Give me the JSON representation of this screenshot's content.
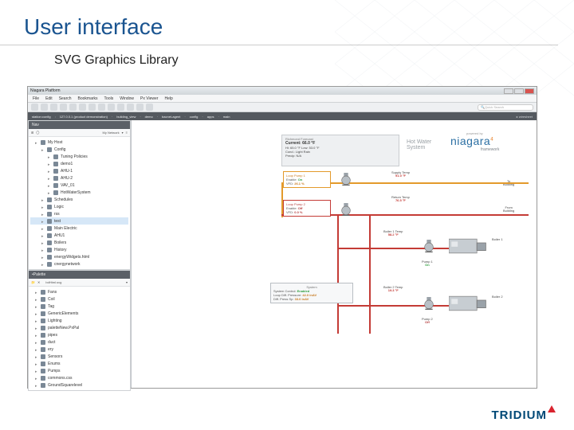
{
  "slide": {
    "title": "User interface",
    "subtitle": "SVG Graphics Library"
  },
  "window": {
    "title": "Niagara Platform"
  },
  "menu": [
    "File",
    "Edit",
    "Search",
    "Bookmarks",
    "Tools",
    "Window",
    "Px Viewer",
    "Help"
  ],
  "toolbar": {
    "search_placeholder": "Quick Search"
  },
  "path": {
    "crumbs": [
      "station:config",
      "127.0.0.1 (product demonstration)",
      "building_view",
      "demo",
      "bacnet-agent",
      "config",
      "apps",
      "main"
    ],
    "right": "wiresheet"
  },
  "nav": {
    "title": "Nav",
    "selector": "My Network",
    "items": [
      {
        "label": "My Host",
        "indent": 0
      },
      {
        "label": "Config",
        "indent": 1
      },
      {
        "label": "Tuning Policies",
        "indent": 2
      },
      {
        "label": "demo1",
        "indent": 2
      },
      {
        "label": "AHU-1",
        "indent": 2
      },
      {
        "label": "AHU-2",
        "indent": 2
      },
      {
        "label": "VAV_01",
        "indent": 2
      },
      {
        "label": "HotWaterSystem",
        "indent": 2,
        "sel": false
      },
      {
        "label": "Schedules",
        "indent": 1
      },
      {
        "label": "Logic",
        "indent": 1
      },
      {
        "label": "rss",
        "indent": 1
      },
      {
        "label": "test",
        "indent": 1,
        "sel": true
      },
      {
        "label": "Main Electric",
        "indent": 1
      },
      {
        "label": "AHU1",
        "indent": 1
      },
      {
        "label": "Boilers",
        "indent": 1
      },
      {
        "label": "History",
        "indent": 1
      },
      {
        "label": "energyWidgets.html",
        "indent": 1
      },
      {
        "label": "cnergynetwork",
        "indent": 1
      }
    ]
  },
  "palette": {
    "title": "Palette",
    "selector": "bdHtml.svg",
    "items": [
      {
        "label": "Fans"
      },
      {
        "label": "Coil"
      },
      {
        "label": "Tag"
      },
      {
        "label": "GenericElements"
      },
      {
        "label": "Lighting"
      },
      {
        "label": "paletteNew.PxPal"
      },
      {
        "label": "pipes"
      },
      {
        "label": "duct"
      },
      {
        "label": "ery"
      },
      {
        "label": "Sensors"
      },
      {
        "label": "Enums"
      },
      {
        "label": "Pumps"
      },
      {
        "label": "commons.css"
      },
      {
        "label": "GroundSquarelevel"
      }
    ]
  },
  "forecast": {
    "title": "Richmond Forecast",
    "current_label": "Current:",
    "current": "66.0 °F",
    "hi_lo": "Hi: 65.0 °F  Low: 53.0 °F",
    "cond": "Cond.: Light Rain",
    "precip": "Precip: N/A"
  },
  "hws_label": "Hot Water\nSystem",
  "niagara": {
    "powered": "powered by",
    "brand": "niagara",
    "sup": "4",
    "sub": "framework"
  },
  "loop1": {
    "title": "Loop Pump 1",
    "enable_l": "Enable:",
    "enable_v": "On",
    "vfd_l": "VFD:",
    "vfd_v": "26.1 %"
  },
  "loop2": {
    "title": "Loop Pump 2",
    "enable_l": "Enable:",
    "enable_v": "Off",
    "vfd_l": "VFD:",
    "vfd_v": "0.0 %"
  },
  "supply": {
    "label": "Supply Temp",
    "val": "91.0 °F"
  },
  "return": {
    "label": "Return Temp",
    "val": "76.5 °F"
  },
  "to_bldg": "To\nBuilding",
  "from_bldg": "From\nBuilding",
  "boiler1": {
    "label": "Boiler 1 Temp",
    "val": "58.2 °F",
    "name": "Boiler 1"
  },
  "boiler2": {
    "label": "Boiler 2 Temp",
    "val": "19.3 °F",
    "name": "Boiler 2"
  },
  "pump1": {
    "label": "Pump 1",
    "state": "On"
  },
  "pump2": {
    "label": "Pump 2",
    "state": "Off"
  },
  "system_box": {
    "title": "System",
    "ctrl_l": "System Control:",
    "ctrl_v": "Enabled",
    "loop_l": "Loop Diff. Pressure:",
    "loop_v": "42.0 inAV",
    "diff_l": "Diff. Press Sp:",
    "diff_v": "33.0 inAV"
  },
  "footer_brand": "TRIDIUM"
}
